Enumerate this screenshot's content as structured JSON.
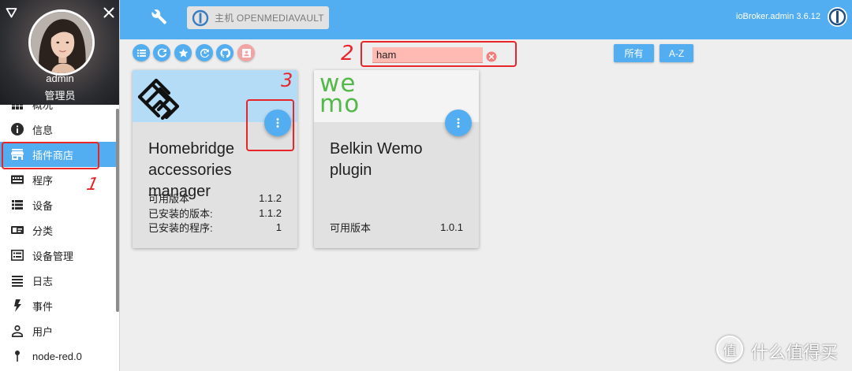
{
  "colors": {
    "primary": "#52aef0",
    "annotation": "#e8262a",
    "search_bg": "#ffbab3",
    "wemo_green": "#55b84a",
    "card_body": "#e1e1e1",
    "page_bg": "#eeeeee",
    "pink_button": "#f2a3a3",
    "homebridge_header": "#b5dcf7",
    "wemo_header": "#f4f4f4"
  },
  "sidebar": {
    "profile": {
      "username": "admin",
      "role": "管理员"
    },
    "items": [
      {
        "label": "概况",
        "icon": "dashboard-icon"
      },
      {
        "label": "信息",
        "icon": "info-icon"
      },
      {
        "label": "插件商店",
        "icon": "store-icon",
        "selected": true
      },
      {
        "label": "程序",
        "icon": "instances-icon"
      },
      {
        "label": "设备",
        "icon": "list-icon"
      },
      {
        "label": "分类",
        "icon": "categories-icon"
      },
      {
        "label": "设备管理",
        "icon": "device-manager-icon"
      },
      {
        "label": "日志",
        "icon": "log-icon"
      },
      {
        "label": "事件",
        "icon": "bolt-icon"
      },
      {
        "label": "用户",
        "icon": "user-icon"
      },
      {
        "label": "node-red.0",
        "icon": "pin-icon"
      }
    ]
  },
  "topbar": {
    "host_label": "主机 OPENMEDIAVAULT",
    "version": "ioBroker.admin 3.6.12"
  },
  "toolbar": {
    "buttons": [
      "list-view-icon",
      "refresh-icon",
      "star-icon",
      "update-icon",
      "github-icon",
      "contacts-icon"
    ],
    "search": {
      "value": "ham"
    },
    "filter_all": "所有",
    "sort_az": "A-Z"
  },
  "adapters": [
    {
      "title": "Homebridge accessories manager",
      "rows": [
        {
          "label": "可用版本",
          "value": "1.1.2"
        },
        {
          "label": "已安装的版本:",
          "value": "1.1.2"
        },
        {
          "label": "已安装的程序:",
          "value": "1"
        }
      ]
    },
    {
      "title": "Belkin Wemo plugin",
      "logo_lines": [
        "we",
        "mo"
      ],
      "rows": [
        {
          "label": "可用版本",
          "value": "1.0.1"
        }
      ]
    }
  ],
  "annotations": [
    "1",
    "2",
    "3"
  ],
  "watermark": {
    "logo": "值",
    "text": "什么值得买"
  }
}
